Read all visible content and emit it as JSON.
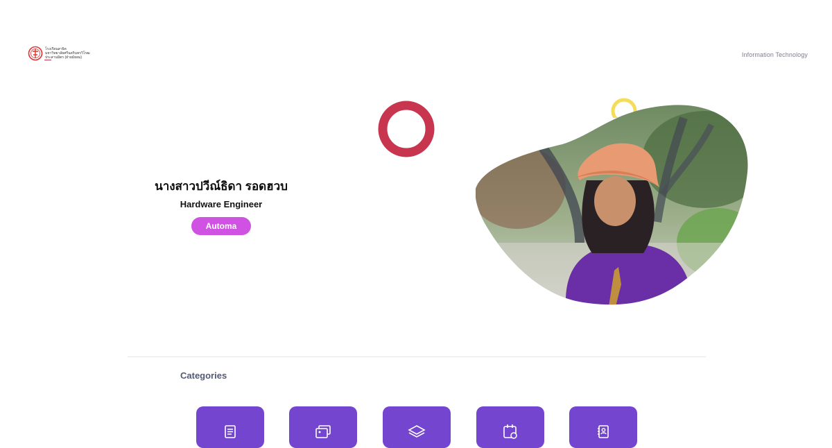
{
  "header": {
    "logo_lines": [
      "โรงเรียนสาธิต",
      "มหาวิทยาลัยศรีนครินทรวิโรฒ",
      "ประสานมิตร (ฝ่ายมัธยม)"
    ],
    "nav_label": "Information Technology"
  },
  "profile": {
    "name": "นางสาวปวีณ์ธิดา รอดฮวบ",
    "role": "Hardware Engineer",
    "tag": "Automa"
  },
  "categories": {
    "title": "Categories",
    "items": [
      {
        "icon": "document-icon"
      },
      {
        "icon": "image-gallery-icon"
      },
      {
        "icon": "layers-icon"
      },
      {
        "icon": "calendar-icon"
      },
      {
        "icon": "contact-book-icon"
      }
    ]
  },
  "colors": {
    "accent_purple": "#7445cf",
    "tag_pink": "#d052e3",
    "ring_red": "#c8354f",
    "ring_yellow": "#f5dc5b"
  }
}
